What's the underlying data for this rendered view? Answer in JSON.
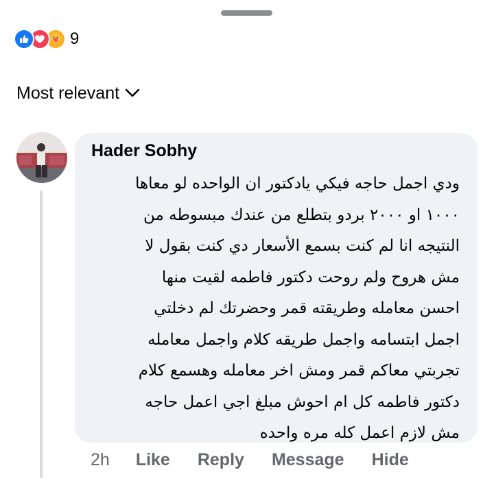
{
  "reactions": {
    "icons": [
      "thumbs-up-icon",
      "heart-icon",
      "care-hug-icon"
    ],
    "count": "9",
    "colors": {
      "like": "#1877f2",
      "love": "#f33e58",
      "care": "#f7b125"
    }
  },
  "sort": {
    "label": "Most relevant"
  },
  "comment": {
    "author": "Hader Sobhy",
    "lines": [
      "ودي اجمل حاجه فيكي يادكتور ان الواحده لو معاها",
      "١٠٠٠ او ٢٠٠٠ بردو بتطلع من عندك مبسوطه من",
      "النتيجه انا لم كنت بسمع الأسعار دي كنت بقول لا",
      "مش هروح  ولم روحت دكتور فاطمه لقيت منها",
      "احسن معامله وطريقته قمر وحضرتك لم دخلتي",
      "اجمل ابتسامه واجمل طريقه كلام واجمل معامله",
      "تجربتي معاكم قمر ومش اخر معامله وهسمع كلام",
      "دكتور فاطمه كل ام احوش مبلغ اجي اعمل حاجه",
      "مش لازم اعمل كله مره واحده"
    ],
    "time": "2h",
    "actions": {
      "like": "Like",
      "reply": "Reply",
      "message": "Message",
      "hide": "Hide"
    }
  }
}
